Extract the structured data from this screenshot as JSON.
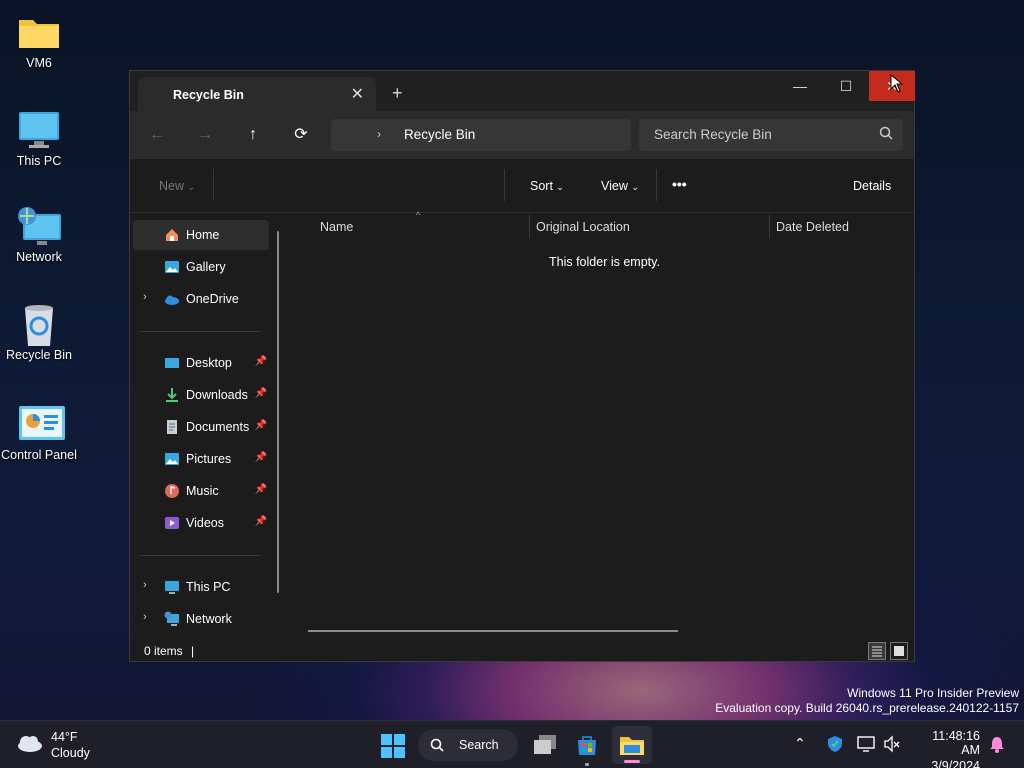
{
  "desktop": {
    "icons": [
      {
        "label": "VM6",
        "icon": "folder-icon"
      },
      {
        "label": "This PC",
        "icon": "monitor-icon"
      },
      {
        "label": "Network",
        "icon": "network-icon"
      },
      {
        "label": "Recycle Bin",
        "icon": "recycle-bin-icon"
      },
      {
        "label": "Control Panel",
        "icon": "control-panel-icon"
      }
    ]
  },
  "window": {
    "tab_title": "Recycle Bin",
    "address": "Recycle Bin",
    "search_placeholder": "Search Recycle Bin",
    "commands": {
      "new": "New",
      "sort": "Sort",
      "view": "View",
      "more": "•••",
      "details": "Details"
    },
    "sidebar": {
      "top": [
        {
          "label": "Home",
          "icon": "home-icon",
          "selected": true
        },
        {
          "label": "Gallery",
          "icon": "gallery-icon"
        },
        {
          "label": "OneDrive",
          "icon": "onedrive-icon",
          "expandable": true
        }
      ],
      "pinned": [
        {
          "label": "Desktop",
          "icon": "desktop-icon"
        },
        {
          "label": "Downloads",
          "icon": "downloads-icon"
        },
        {
          "label": "Documents",
          "icon": "documents-icon"
        },
        {
          "label": "Pictures",
          "icon": "pictures-icon"
        },
        {
          "label": "Music",
          "icon": "music-icon"
        },
        {
          "label": "Videos",
          "icon": "videos-icon"
        }
      ],
      "bottom": [
        {
          "label": "This PC",
          "icon": "this-pc-icon"
        },
        {
          "label": "Network",
          "icon": "network-icon"
        }
      ]
    },
    "columns": [
      "Name",
      "Original Location",
      "Date Deleted"
    ],
    "empty_message": "This folder is empty.",
    "status": "0 items"
  },
  "watermark": {
    "line1": "Windows 11 Pro Insider Preview",
    "line2": "Evaluation copy. Build 26040.rs_prerelease.240122-1157"
  },
  "taskbar": {
    "weather_temp": "44°F",
    "weather_desc": "Cloudy",
    "search_label": "Search",
    "time": "11:48:16 AM",
    "date": "3/9/2024"
  }
}
